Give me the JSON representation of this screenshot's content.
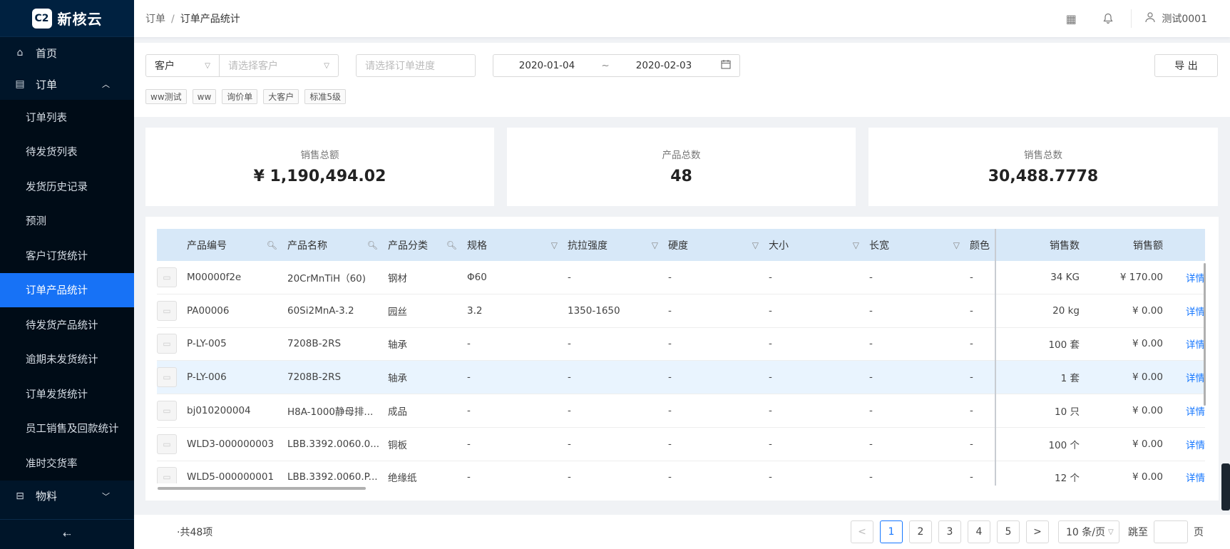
{
  "app": {
    "logo_mark": "C2",
    "logo_text": "新核云"
  },
  "sidebar": {
    "home": "首页",
    "order": "订单",
    "order_items": [
      {
        "label": "订单列表"
      },
      {
        "label": "待发货列表"
      },
      {
        "label": "发货历史记录"
      },
      {
        "label": "预测"
      },
      {
        "label": "客户订货统计"
      },
      {
        "label": "订单产品统计",
        "active": true
      },
      {
        "label": "待发货产品统计"
      },
      {
        "label": "逾期未发货统计"
      },
      {
        "label": "订单发货统计"
      },
      {
        "label": "员工销售及回款统计"
      },
      {
        "label": "准时交货率"
      }
    ],
    "material": "物料"
  },
  "header": {
    "breadcrumb": [
      "订单",
      "订单产品统计"
    ],
    "user": "测试0001"
  },
  "filters": {
    "customer_type": "客户",
    "customer_placeholder": "请选择客户",
    "progress_placeholder": "请选择订单进度",
    "date_start": "2020-01-04",
    "date_sep": "~",
    "date_end": "2020-02-03",
    "export_label": "导 出",
    "tags": [
      "ww测试",
      "ww",
      "询价单",
      "大客户",
      "标准5级"
    ]
  },
  "stats": {
    "sales_total_label": "销售总额",
    "sales_total_value": "¥ 1,190,494.02",
    "product_count_label": "产品总数",
    "product_count_value": "48",
    "sales_qty_label": "销售总数",
    "sales_qty_value": "30,488.7778"
  },
  "table": {
    "columns": {
      "code": "产品编号",
      "name": "产品名称",
      "category": "产品分类",
      "spec": "规格",
      "tensile": "抗拉强度",
      "hardness": "硬度",
      "size": "大小",
      "lw": "长宽",
      "color": "颜色",
      "qty": "销售数",
      "amount": "销售额"
    },
    "rows": [
      {
        "code": "M00000f2e",
        "name": "20CrMnTiH（60)",
        "category": "钢材",
        "spec": "Φ60",
        "tensile": "-",
        "hardness": "-",
        "size": "-",
        "lw": "-",
        "color": "-",
        "qty": "34 KG",
        "amount": "¥ 170.00",
        "action": "详情"
      },
      {
        "code": "PA00006",
        "name": "60Si2MnA-3.2",
        "category": "园丝",
        "spec": "3.2",
        "tensile": "1350-1650",
        "hardness": "-",
        "size": "-",
        "lw": "-",
        "color": "-",
        "qty": "20 kg",
        "amount": "¥ 0.00",
        "action": "详情"
      },
      {
        "code": "P-LY-005",
        "name": "7208B-2RS",
        "category": "轴承",
        "spec": "-",
        "tensile": "-",
        "hardness": "-",
        "size": "-",
        "lw": "-",
        "color": "-",
        "qty": "100 套",
        "amount": "¥ 0.00",
        "action": "详情"
      },
      {
        "code": "P-LY-006",
        "name": "7208B-2RS",
        "category": "轴承",
        "spec": "-",
        "tensile": "-",
        "hardness": "-",
        "size": "-",
        "lw": "-",
        "color": "-",
        "qty": "1 套",
        "amount": "¥ 0.00",
        "action": "详情"
      },
      {
        "code": "bj010200004",
        "name": "H8A-1000静母排...",
        "category": "成品",
        "spec": "-",
        "tensile": "-",
        "hardness": "-",
        "size": "-",
        "lw": "-",
        "color": "-",
        "qty": "10 只",
        "amount": "¥ 0.00",
        "action": "详情"
      },
      {
        "code": "WLD3-000000003",
        "name": "LBB.3392.0060.0...",
        "category": "铜板",
        "spec": "-",
        "tensile": "-",
        "hardness": "-",
        "size": "-",
        "lw": "-",
        "color": "-",
        "qty": "100 个",
        "amount": "¥ 0.00",
        "action": "详情"
      },
      {
        "code": "WLD5-000000001",
        "name": "LBB.3392.0060.P...",
        "category": "绝缘纸",
        "spec": "-",
        "tensile": "-",
        "hardness": "-",
        "size": "-",
        "lw": "-",
        "color": "-",
        "qty": "12 个",
        "amount": "¥ 0.00",
        "action": "详情"
      }
    ]
  },
  "pagination": {
    "total": "·共48项",
    "pages": [
      "1",
      "2",
      "3",
      "4",
      "5"
    ],
    "current": "1",
    "prev": "<",
    "next": ">",
    "page_size": "10 条/页",
    "jump_label": "跳至",
    "page_unit": "页"
  },
  "colors": {
    "sidebar_bg": "#001529",
    "active": "#1772f6",
    "link": "#1677ff",
    "table_header": "#d7e8f8"
  }
}
